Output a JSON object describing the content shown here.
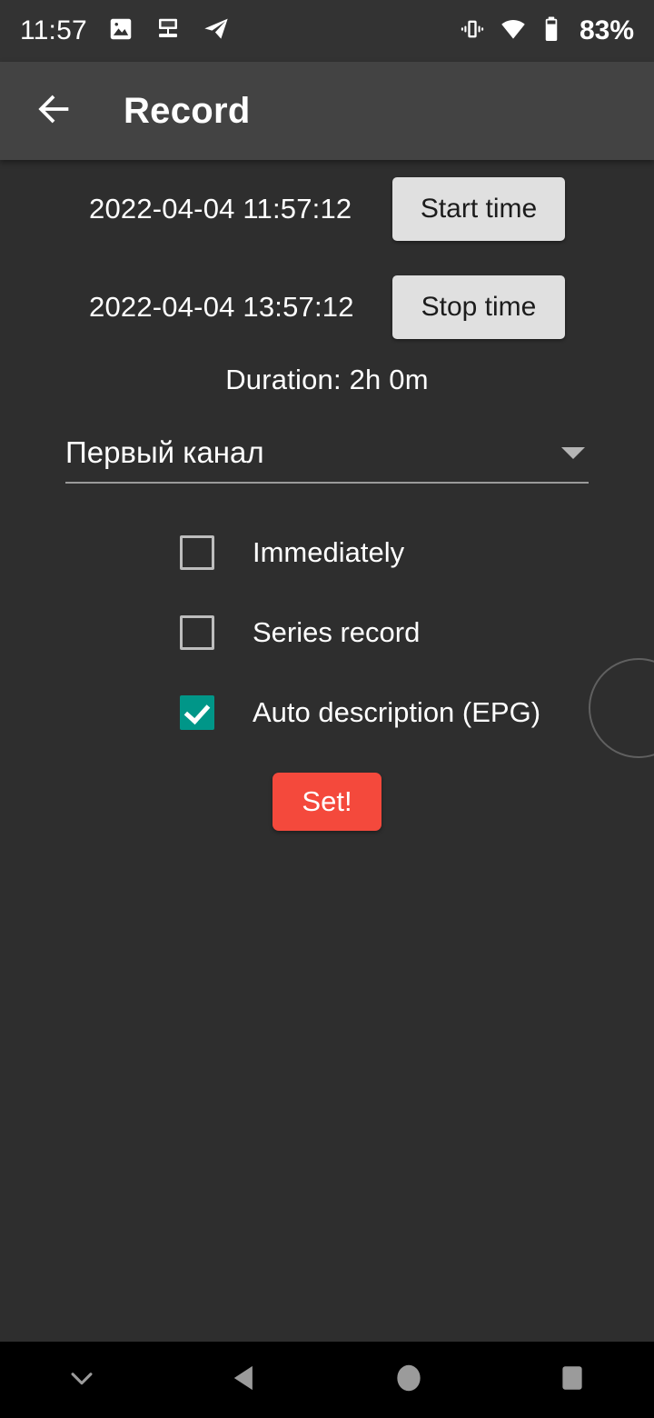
{
  "status_bar": {
    "clock": "11:57",
    "battery_percent": "83%",
    "left_icons": [
      "image-icon",
      "cast-screen-icon",
      "telegram-icon"
    ],
    "right_icons": [
      "vibrate-icon",
      "wifi-icon",
      "battery-icon"
    ]
  },
  "app_bar": {
    "back_icon": "arrow-back-icon",
    "title": "Record"
  },
  "form": {
    "start_time_value": "2022-04-04 11:57:12",
    "start_time_button": "Start time",
    "stop_time_value": "2022-04-04 13:57:12",
    "stop_time_button": "Stop time",
    "duration": "Duration: 2h 0m",
    "channel": {
      "selected": "Первый канал",
      "caret_icon": "chevron-down-icon"
    },
    "checkboxes": [
      {
        "label": "Immediately",
        "checked": false
      },
      {
        "label": "Series record",
        "checked": false
      },
      {
        "label": "Auto description (EPG)",
        "checked": true
      }
    ],
    "submit_button": "Set!"
  },
  "colors": {
    "status_bar_bg": "#333333",
    "app_bar_bg": "#434343",
    "body_bg": "#2e2e2e",
    "button_light": "#e0e0e0",
    "accent_teal": "#009688",
    "accent_red": "#f4493c",
    "nav_bar_bg": "#000000"
  },
  "nav_bar": {
    "items": [
      "keyboard-hide-icon",
      "back-triangle-icon",
      "home-circle-icon",
      "recents-square-icon"
    ]
  }
}
